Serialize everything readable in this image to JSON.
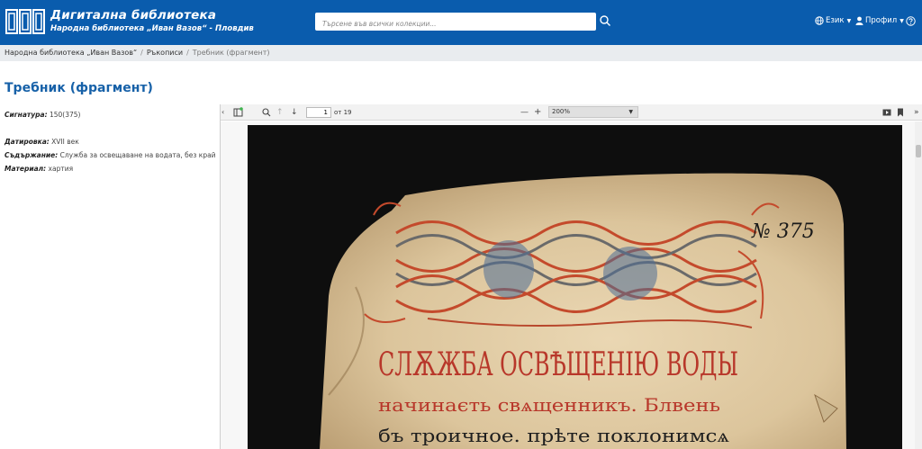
{
  "header": {
    "title": "Дигитална библиотека",
    "subtitle": "Народна библиотека „Иван Вазов“ - Пловдив",
    "search_placeholder": "Търсене във всички колекции...",
    "language_label": "Език",
    "profile_label": "Профил",
    "brand_color": "#0a5cad",
    "icons": [
      "library-logo-icon",
      "search-icon",
      "globe-icon",
      "user-icon",
      "help-icon"
    ]
  },
  "breadcrumb": {
    "items": [
      "Народна библиотека „Иван Вазов“",
      "Ръкописи"
    ],
    "current": "Требник (фрагмент)"
  },
  "record": {
    "title": "Требник (фрагмент)",
    "fields": [
      {
        "label": "Сигнатура:",
        "value": "150(375)"
      },
      {
        "label": "Датировка:",
        "value": "XVII век"
      },
      {
        "label": "Съдържание:",
        "value": "Служба за освещаване на водата, без край"
      },
      {
        "label": "Материал:",
        "value": "хартия"
      }
    ]
  },
  "viewer": {
    "page_current": "1",
    "page_total_text": "от 19",
    "zoom": "200%",
    "zoom_minus": "—",
    "zoom_plus": "+",
    "manuscript_number": "№ 375",
    "manuscript_heading": "СЛѪЖБА ОСВѢЩЕНІЮ ВОДЫ",
    "manuscript_line1": "начинаєть свѧщенникъ. Блвень",
    "manuscript_line2": "бъ троичное. прѣте поклонимсѧ"
  }
}
